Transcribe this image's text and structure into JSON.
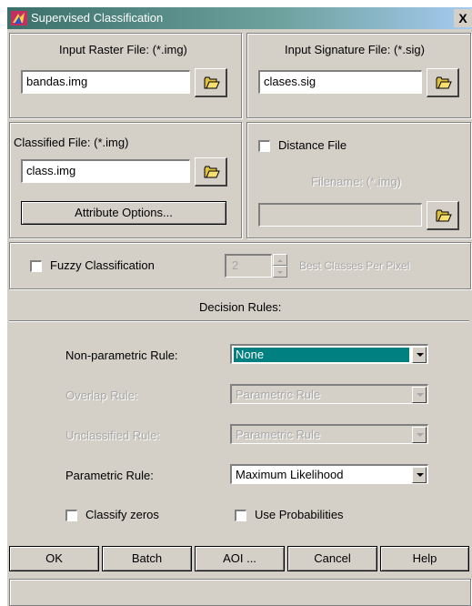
{
  "window": {
    "title": "Supervised Classification",
    "close_glyph": "X"
  },
  "input_raster": {
    "label": "Input Raster File: (*.img)",
    "value": "bandas.img"
  },
  "input_signature": {
    "label": "Input Signature File: (*.sig)",
    "value": "clases.sig"
  },
  "classified": {
    "label": "Classified File: (*.img)",
    "value": "class.img",
    "attribute_button": "Attribute Options..."
  },
  "distance": {
    "checkbox_label": "Distance File",
    "filename_label": "Filename: (*.img)",
    "value": ""
  },
  "fuzzy": {
    "checkbox_label": "Fuzzy Classification",
    "spin_value": "2",
    "suffix_label": "Best Classes Per Pixel"
  },
  "decision_rules": {
    "heading": "Decision Rules:",
    "nonparametric": {
      "label": "Non-parametric Rule:",
      "value": "None"
    },
    "overlap": {
      "label": "Overlap Rule:",
      "value": "Parametric Rule"
    },
    "unclassified": {
      "label": "Unclassified Rule:",
      "value": "Parametric Rule"
    },
    "parametric": {
      "label": "Parametric Rule:",
      "value": "Maximum Likelihood"
    },
    "classify_zeros": "Classify zeros",
    "use_probabilities": "Use Probabilities"
  },
  "buttons": {
    "ok": "OK",
    "batch": "Batch",
    "aoi": "AOI ...",
    "cancel": "Cancel",
    "help": "Help"
  },
  "colors": {
    "face": "#d4d0c8",
    "selection": "#008080",
    "title_start": "#3a6f6a"
  }
}
